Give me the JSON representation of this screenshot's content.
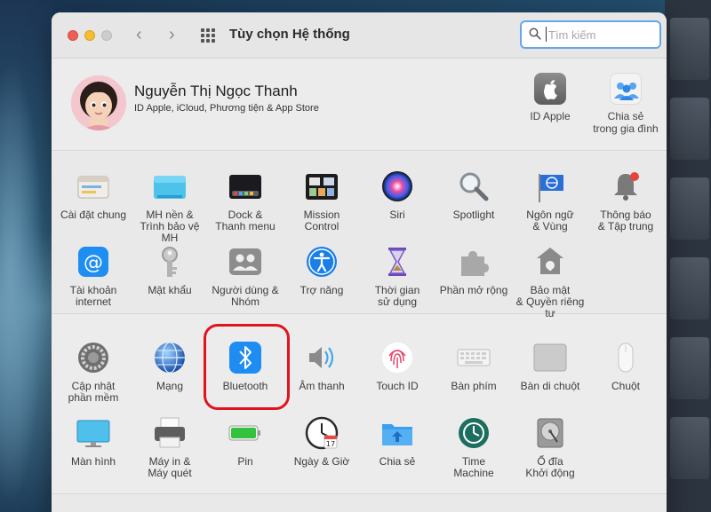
{
  "window": {
    "title": "Tùy chọn Hệ thống",
    "search_placeholder": "Tìm kiếm",
    "nav_back": "‹",
    "nav_forward": "›"
  },
  "profile": {
    "name": "Nguyễn Thị Ngọc Thanh",
    "subtitle": "ID Apple, iCloud, Phương tiện & App Store",
    "items": [
      {
        "label_1": "ID Apple",
        "label_2": "",
        "icon": "apple-id-icon"
      },
      {
        "label_1": "Chia sẻ",
        "label_2": "trong gia đình",
        "icon": "family-sharing-icon"
      }
    ]
  },
  "section1": [
    {
      "l1": "Cài đặt chung",
      "l2": "",
      "icon": "general-icon"
    },
    {
      "l1": "MH nền &",
      "l2": "Trình bảo vệ MH",
      "icon": "desktop-screensaver-icon"
    },
    {
      "l1": "Dock &",
      "l2": "Thanh menu",
      "icon": "dock-icon"
    },
    {
      "l1": "Mission",
      "l2": "Control",
      "icon": "mission-control-icon"
    },
    {
      "l1": "Siri",
      "l2": "",
      "icon": "siri-icon"
    },
    {
      "l1": "Spotlight",
      "l2": "",
      "icon": "spotlight-icon"
    },
    {
      "l1": "Ngôn ngữ",
      "l2": "& Vùng",
      "icon": "language-region-icon"
    },
    {
      "l1": "Thông báo",
      "l2": "& Tập trung",
      "icon": "notifications-icon"
    },
    {
      "l1": "Tài khoản",
      "l2": "internet",
      "icon": "internet-accounts-icon"
    },
    {
      "l1": "Mật khẩu",
      "l2": "",
      "icon": "passwords-icon"
    },
    {
      "l1": "Người dùng &",
      "l2": "Nhóm",
      "icon": "users-groups-icon"
    },
    {
      "l1": "Trợ năng",
      "l2": "",
      "icon": "accessibility-icon"
    },
    {
      "l1": "Thời gian",
      "l2": "sử dụng",
      "icon": "screen-time-icon"
    },
    {
      "l1": "Phần mở rộng",
      "l2": "",
      "icon": "extensions-icon"
    },
    {
      "l1": "Bảo mật",
      "l2": "& Quyền riêng tư",
      "icon": "security-privacy-icon"
    }
  ],
  "section2": [
    {
      "l1": "Cập nhật",
      "l2": "phần mềm",
      "icon": "software-update-icon"
    },
    {
      "l1": "Mạng",
      "l2": "",
      "icon": "network-icon"
    },
    {
      "l1": "Bluetooth",
      "l2": "",
      "icon": "bluetooth-icon"
    },
    {
      "l1": "Âm thanh",
      "l2": "",
      "icon": "sound-icon"
    },
    {
      "l1": "Touch ID",
      "l2": "",
      "icon": "touch-id-icon"
    },
    {
      "l1": "Bàn phím",
      "l2": "",
      "icon": "keyboard-icon"
    },
    {
      "l1": "Bàn di chuột",
      "l2": "",
      "icon": "trackpad-icon"
    },
    {
      "l1": "Chuột",
      "l2": "",
      "icon": "mouse-icon"
    },
    {
      "l1": "Màn hình",
      "l2": "",
      "icon": "displays-icon"
    },
    {
      "l1": "Máy in &",
      "l2": "Máy quét",
      "icon": "printers-scanners-icon"
    },
    {
      "l1": "Pin",
      "l2": "",
      "icon": "battery-icon"
    },
    {
      "l1": "Ngày & Giờ",
      "l2": "",
      "icon": "date-time-icon"
    },
    {
      "l1": "Chia sẻ",
      "l2": "",
      "icon": "sharing-icon"
    },
    {
      "l1": "Time",
      "l2": "Machine",
      "icon": "time-machine-icon"
    },
    {
      "l1": "Ổ đĩa",
      "l2": "Khởi động",
      "icon": "startup-disk-icon"
    }
  ],
  "calendar_day": "17",
  "colors": {
    "highlight": "#e0141e",
    "search_border": "#6aa5ea",
    "bluetooth_blue": "#1e8cf0"
  }
}
